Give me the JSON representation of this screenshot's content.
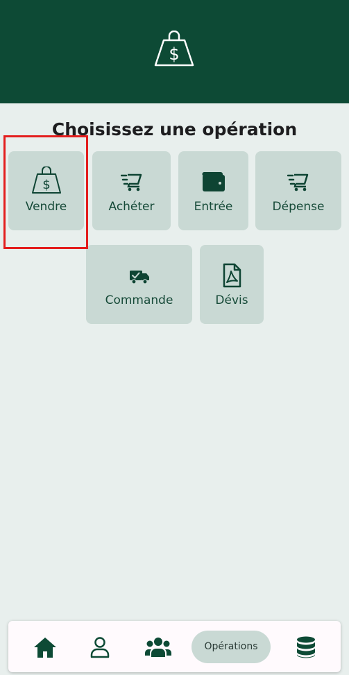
{
  "header": {
    "icon": "money-bag-icon"
  },
  "title": "Choisissez une opération",
  "operations": [
    {
      "label": "Vendre",
      "icon": "money-bag-icon"
    },
    {
      "label": "Achéter",
      "icon": "fast-cart-icon"
    },
    {
      "label": "Entrée",
      "icon": "wallet-icon"
    },
    {
      "label": "Dépense",
      "icon": "fast-cart-icon"
    },
    {
      "label": "Commande",
      "icon": "delivery-truck-icon"
    },
    {
      "label": "Dévis",
      "icon": "pdf-document-icon"
    }
  ],
  "nav": {
    "items": [
      {
        "icon": "home-icon"
      },
      {
        "icon": "user-icon"
      },
      {
        "icon": "group-icon"
      },
      {
        "label": "Opérations"
      },
      {
        "icon": "database-icon"
      }
    ]
  },
  "colors": {
    "brand": "#0d4a35",
    "tile": "#c9d9d4",
    "background": "#e8efed",
    "highlight": "#e31d1d"
  }
}
